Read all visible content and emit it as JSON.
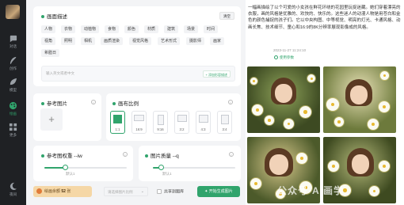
{
  "sidebar": {
    "items": [
      {
        "label": "对话",
        "icon": "chat-bubble-icon",
        "active": false
      },
      {
        "label": "创作",
        "icon": "feather-icon",
        "active": false
      },
      {
        "label": "模型",
        "icon": "leaf-icon",
        "active": false
      },
      {
        "label": "绘画",
        "icon": "palette-icon",
        "active": true
      },
      {
        "label": "更多",
        "icon": "grid-icon",
        "active": false
      }
    ],
    "bottom": {
      "label": "夜间",
      "icon": "moon-icon"
    }
  },
  "prompt_section": {
    "title": "画面描述",
    "clear_label": "清空",
    "tags": [
      "人物",
      "衣物",
      "动植物",
      "食物",
      "颜色",
      "材质",
      "建筑",
      "场景",
      "时间",
      "视角",
      "照明",
      "相机",
      "画质渲染",
      "视觉风格",
      "艺术形式",
      "摄影师",
      "画家",
      "希腊日"
    ],
    "input_placeholder": "输入英文或者中文",
    "add_button_label": "+ 添加形容描述"
  },
  "reference_section": {
    "title": "参考图片",
    "upload_symbol": "+"
  },
  "ratio_section": {
    "title": "画布比例",
    "options": [
      {
        "label": "1:1",
        "active": true
      },
      {
        "label": "16:9",
        "active": false
      },
      {
        "label": "9:16",
        "active": false
      },
      {
        "label": "3:2",
        "active": false
      },
      {
        "label": "4:3",
        "active": false
      },
      {
        "label": "3:4",
        "active": false
      }
    ]
  },
  "weight_section": {
    "title": "参考图权重 --iw",
    "value_label": "默认1",
    "value": 0.25
  },
  "quality_section": {
    "title": "图片质量 --q",
    "value_label": "默认1",
    "value": 0.1
  },
  "footer": {
    "points_prefix": "绘画余额",
    "points_value": "52",
    "points_suffix": "张",
    "select_placeholder": "请选择图片比例",
    "share_label": "共享到图库",
    "generate_label": "开始生成图片"
  },
  "result": {
    "description": "一幅画描绘了以个可爱的小女孩在鲜花环绕的花园里玩捉迷藏。她们穿着漂亮的衣服，画的风格是优雅的、欢快的、快乐的。这些迷人的动漫人物是用苍白和金色的颜色捕捉的孩子们。它以中央构图、中等视觉、明亮的灯光、卡通风格、动画长焦、技术细节、童心和16:9的8K分辨率展现影像成的风格。",
    "date": "2023-11-27 11:24:10",
    "badge": "使用参数",
    "watermark": "公众号·AI画学"
  },
  "colors": {
    "accent": "#30a46c",
    "sidebar": "#1f2124",
    "points_bg": "#f5d7a6"
  }
}
